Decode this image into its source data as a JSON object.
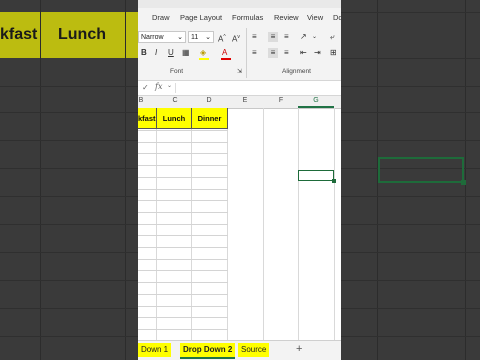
{
  "background_sheet": {
    "headers": [
      "kfast",
      "Lunch"
    ]
  },
  "ribbon": {
    "tabs": [
      "Draw",
      "Page Layout",
      "Formulas",
      "Review",
      "View",
      "Do"
    ],
    "font_name": "Narrow",
    "font_size": "11",
    "font_group_label": "Font",
    "alignment_group_label": "Alignment"
  },
  "formula_bar": {
    "fx": "fx"
  },
  "columns": [
    "B",
    "C",
    "D",
    "E",
    "F",
    "G"
  ],
  "header_row": {
    "breakfast": "kfast",
    "lunch": "Lunch",
    "dinner": "Dinner"
  },
  "sheet_tabs": [
    "Down 1",
    "Drop Down 2",
    "Source"
  ],
  "active_sheet": "Drop Down 2",
  "add_sheet": "+",
  "colors": {
    "header_fill": "#ffff00",
    "excel_green": "#217346",
    "selection": "#1e6b3a"
  }
}
